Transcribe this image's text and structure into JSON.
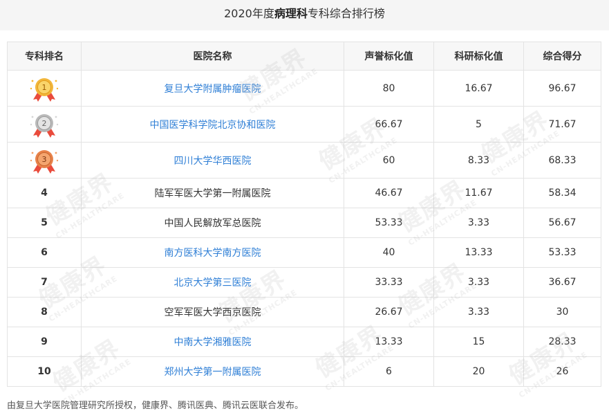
{
  "page": {
    "title_prefix": "2020年度",
    "title_bold": "病理科",
    "title_suffix": "专科综合排行榜"
  },
  "table": {
    "headers": [
      "专科排名",
      "医院名称",
      "声誉标化值",
      "科研标化值",
      "综合得分"
    ],
    "rows": [
      {
        "rank": "1",
        "hospital": "复旦大学附属肿瘤医院",
        "reputation": "80",
        "research": "16.67",
        "score": "96.67"
      },
      {
        "rank": "2",
        "hospital": "中国医学科学院北京协和医院",
        "reputation": "66.67",
        "research": "5",
        "score": "71.67"
      },
      {
        "rank": "3",
        "hospital": "四川大学华西医院",
        "reputation": "60",
        "research": "8.33",
        "score": "68.33"
      },
      {
        "rank": "4",
        "hospital": "陆军军医大学第一附属医院",
        "reputation": "46.67",
        "research": "11.67",
        "score": "58.34"
      },
      {
        "rank": "5",
        "hospital": "中国人民解放军总医院",
        "reputation": "53.33",
        "research": "3.33",
        "score": "56.67"
      },
      {
        "rank": "6",
        "hospital": "南方医科大学南方医院",
        "reputation": "40",
        "research": "13.33",
        "score": "53.33"
      },
      {
        "rank": "7",
        "hospital": "北京大学第三医院",
        "reputation": "33.33",
        "research": "3.33",
        "score": "36.67"
      },
      {
        "rank": "8",
        "hospital": "空军军医大学西京医院",
        "reputation": "26.67",
        "research": "3.33",
        "score": "30"
      },
      {
        "rank": "9",
        "hospital": "中南大学湘雅医院",
        "reputation": "13.33",
        "research": "15",
        "score": "28.33"
      },
      {
        "rank": "10",
        "hospital": "郑州大学第一附属医院",
        "reputation": "6",
        "research": "20",
        "score": "26"
      }
    ]
  },
  "watermark": {
    "big": "健康界",
    "small": "CN-HEALTHCARE"
  },
  "footer": "由复旦大学医院管理研究所授权，健康界、腾讯医典、腾讯云医联合发布。",
  "colors": {
    "link": "#2f7fd6",
    "gold": "#f2b63a",
    "silver": "#b9b9b9",
    "bronze": "#e8824a",
    "ribbon": "#e94b3c"
  }
}
